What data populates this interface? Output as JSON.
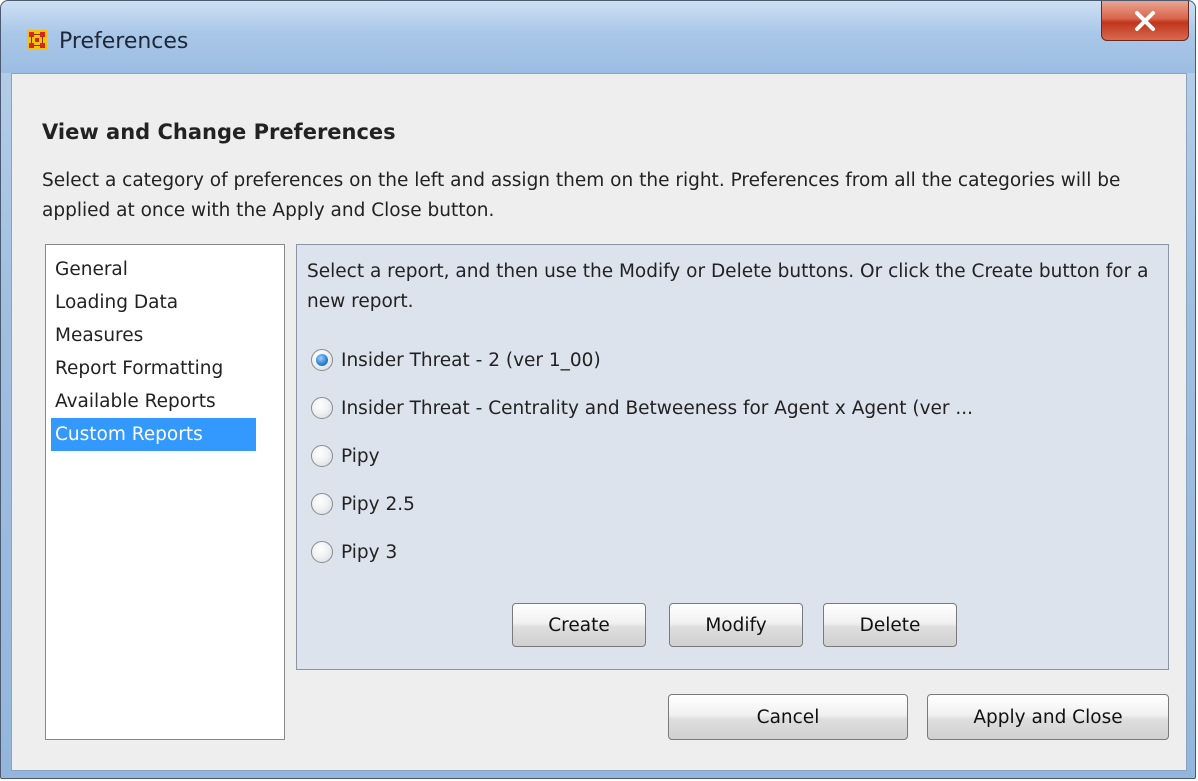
{
  "window": {
    "title": "Preferences",
    "close_glyph": "X"
  },
  "header": {
    "heading": "View and Change Preferences",
    "description": "Select a category of preferences on the left and assign them on the right. Preferences from all the categories will be applied at once with the Apply and Close button."
  },
  "categories": {
    "items": [
      {
        "label": "General"
      },
      {
        "label": "Loading Data"
      },
      {
        "label": "Measures"
      },
      {
        "label": "Report Formatting"
      },
      {
        "label": "Available Reports"
      },
      {
        "label": "Custom Reports"
      }
    ],
    "selected": "Custom Reports"
  },
  "custom_reports": {
    "instructions": "Select a report, and then use the Modify or Delete buttons. Or click the Create button for a new report.",
    "reports": [
      {
        "label": "Insider Threat - 2 (ver 1_00)",
        "checked": true
      },
      {
        "label": "Insider Threat - Centrality and Betweeness for Agent x Agent  (ver ...",
        "checked": false
      },
      {
        "label": "Pipy",
        "checked": false
      },
      {
        "label": "Pipy 2.5",
        "checked": false
      },
      {
        "label": "Pipy 3",
        "checked": false
      }
    ],
    "buttons": {
      "create": "Create",
      "modify": "Modify",
      "delete": "Delete"
    }
  },
  "footer": {
    "cancel": "Cancel",
    "apply_and_close": "Apply and Close"
  },
  "colors": {
    "selection": "#3399ff",
    "panel_bg": "#dce3ed",
    "client_bg": "#eeeeee",
    "close_button": "#c0351b"
  },
  "icons": {
    "app": "grid-network-icon",
    "close": "close-icon",
    "radio_checked": "radio-checked-icon",
    "radio_unchecked": "radio-unchecked-icon"
  }
}
